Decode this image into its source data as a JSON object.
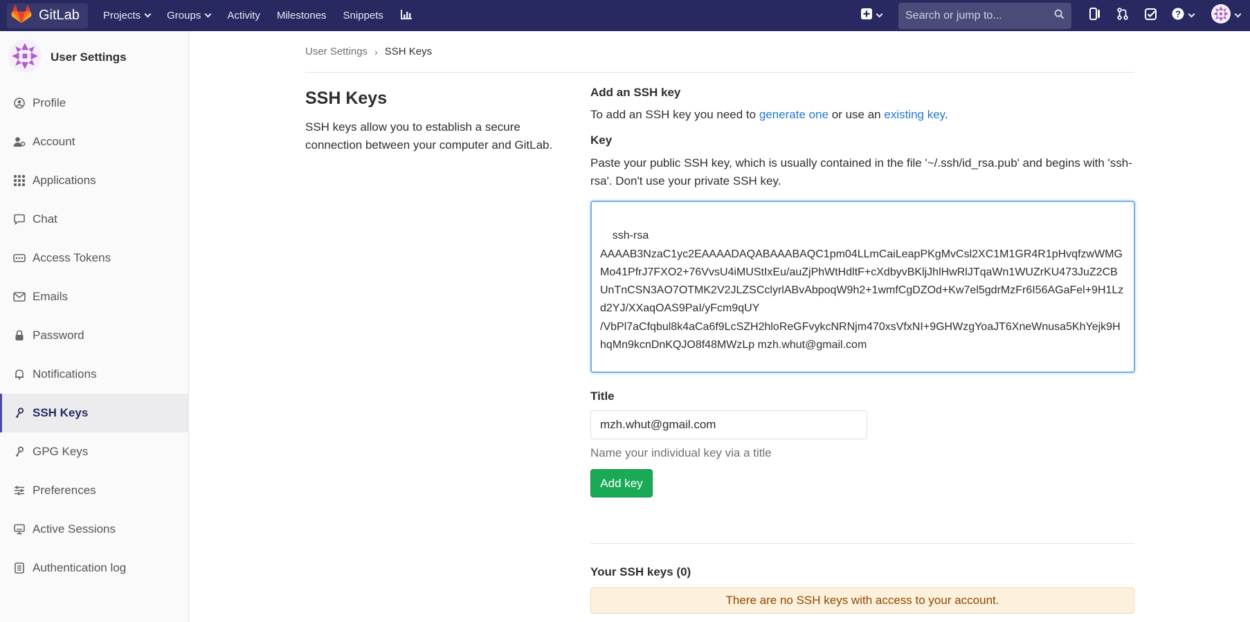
{
  "navbar": {
    "brand": "GitLab",
    "links": [
      {
        "label": "Projects",
        "dropdown": true
      },
      {
        "label": "Groups",
        "dropdown": true
      },
      {
        "label": "Activity",
        "dropdown": false
      },
      {
        "label": "Milestones",
        "dropdown": false
      },
      {
        "label": "Snippets",
        "dropdown": false
      }
    ],
    "search_placeholder": "Search or jump to..."
  },
  "sidebar": {
    "title": "User Settings",
    "items": [
      {
        "label": "Profile",
        "icon": "profile-icon"
      },
      {
        "label": "Account",
        "icon": "account-icon"
      },
      {
        "label": "Applications",
        "icon": "applications-icon"
      },
      {
        "label": "Chat",
        "icon": "chat-icon"
      },
      {
        "label": "Access Tokens",
        "icon": "access-tokens-icon"
      },
      {
        "label": "Emails",
        "icon": "email-icon"
      },
      {
        "label": "Password",
        "icon": "lock-icon"
      },
      {
        "label": "Notifications",
        "icon": "bell-icon"
      },
      {
        "label": "SSH Keys",
        "icon": "key-icon",
        "active": true
      },
      {
        "label": "GPG Keys",
        "icon": "key-icon"
      },
      {
        "label": "Preferences",
        "icon": "preferences-icon"
      },
      {
        "label": "Active Sessions",
        "icon": "monitor-icon"
      },
      {
        "label": "Authentication log",
        "icon": "log-icon"
      }
    ]
  },
  "breadcrumb": {
    "parent": "User Settings",
    "current": "SSH Keys"
  },
  "intro": {
    "title": "SSH Keys",
    "description": "SSH keys allow you to establish a secure connection between your computer and GitLab."
  },
  "form": {
    "add_heading": "Add an SSH key",
    "add_text_before": "To add an SSH key you need to ",
    "generate_link": "generate one",
    "add_text_middle": " or use an ",
    "existing_link": "existing key",
    "add_text_after": ".",
    "key_label": "Key",
    "key_help": "Paste your public SSH key, which is usually contained in the file '~/.ssh/id_rsa.pub' and begins with 'ssh-rsa'. Don't use your private SSH key.",
    "key_value": "ssh-rsa\nAAAAB3NzaC1yc2EAAAADAQABAAABAQC1pm04LLmCaiLeapPKgMvCsl2XC1M1GR4R1pHvqfzwWMGMo41PfrJ7FXO2+76VvsU4iMUStIxEu/auZjPhWtHdltF+cXdbyvBKljJhlHwRlJTqaWn1WUZrKU473JuZ2CBUnTnCSN3AO7OTMK2V2JLZSCclyrlABvAbpoqW9h2+1wmfCgDZOd+Kw7el5gdrMzFr6I56AGaFel+9H1Lzd2YJ/XXaqOAS9PaI/yFcm9qUY\n/VbPl7aCfqbul8k4aCa6f9LcSZH2hloReGFvykcNRNjm470xsVfxNI+9GHWzgYoaJT6XneWnusa5KhYejk9HhqMn9kcnDnKQJO8f48MWzLp mzh.whut@gmail.com",
    "title_label": "Title",
    "title_value": "mzh.whut@gmail.com",
    "title_help": "Name your individual key via a title",
    "submit_label": "Add key"
  },
  "keys_list": {
    "heading": "Your SSH keys (0)",
    "empty_message": "There are no SSH keys with access to your account."
  },
  "colors": {
    "navbar_bg": "#292961",
    "link": "#1f78d1",
    "success_button": "#1aaa55",
    "warning_bg": "#fdf1dd",
    "warning_text": "#8f4700"
  }
}
